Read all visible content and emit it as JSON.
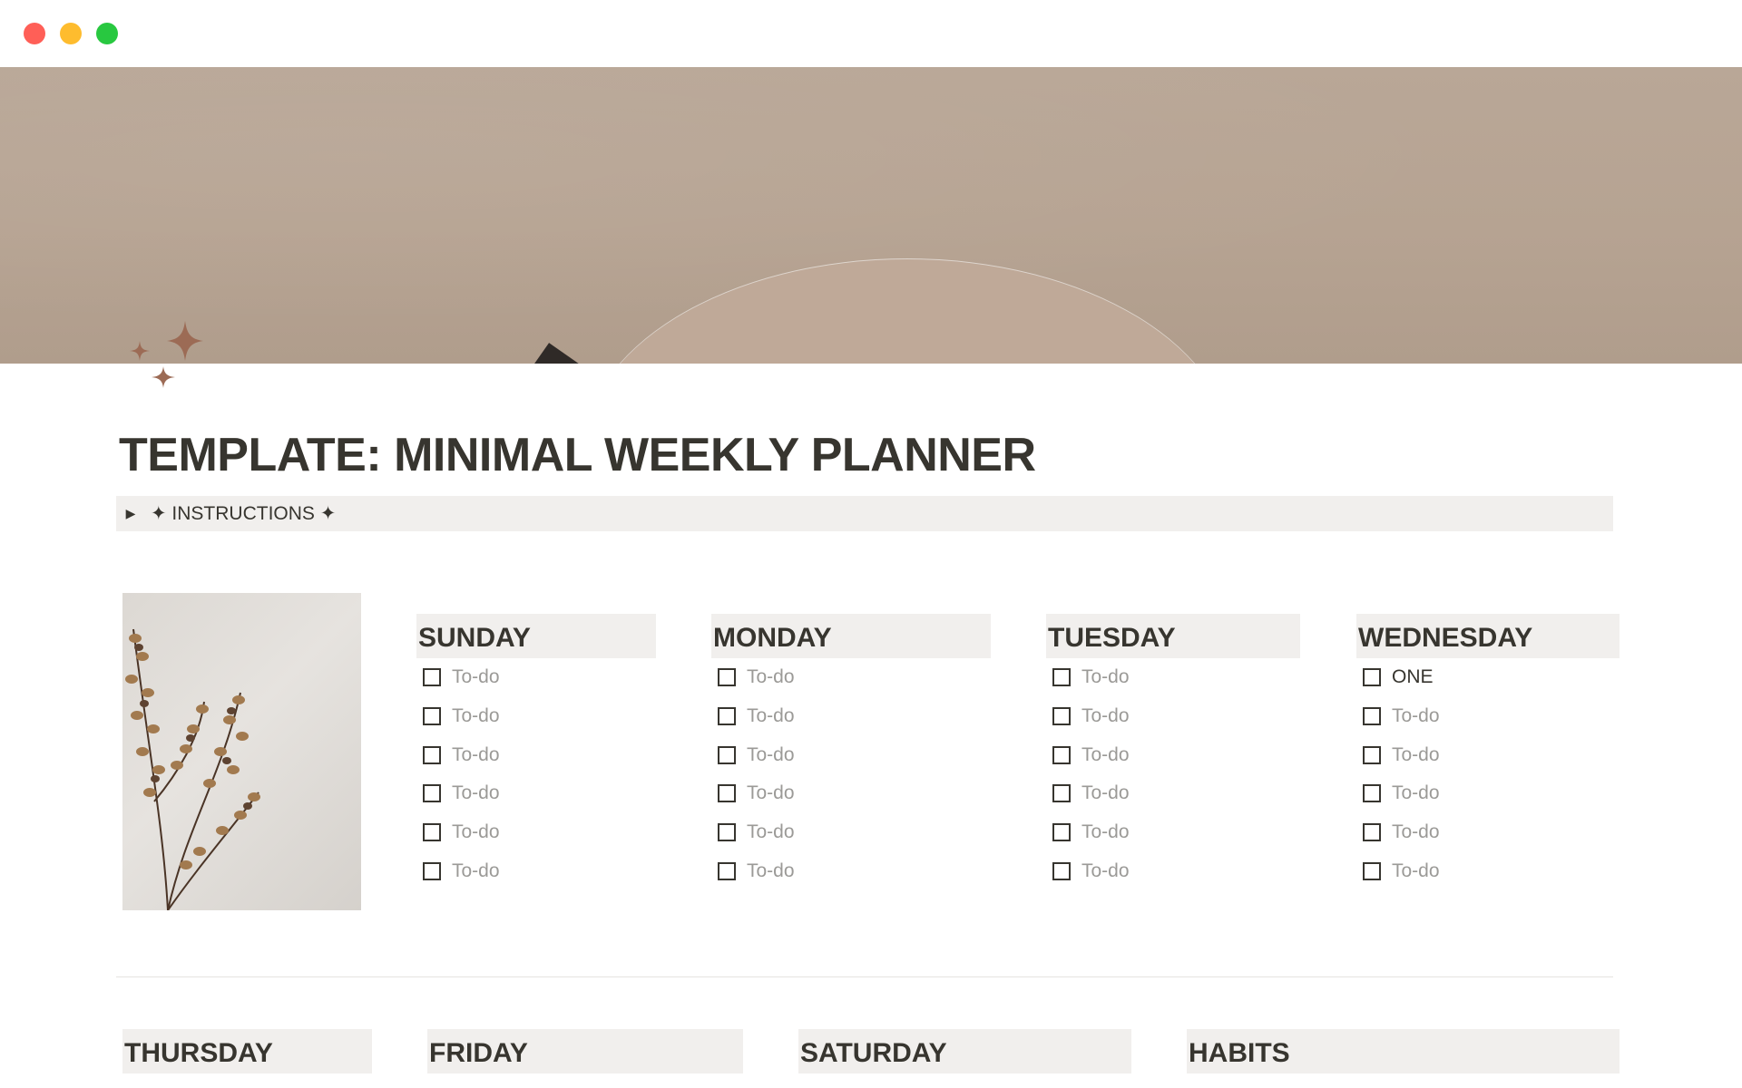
{
  "page": {
    "title": "TEMPLATE: MINIMAL WEEKLY PLANNER",
    "icon": "sparkles-icon",
    "accent_color": "#9c6b55"
  },
  "instructions": {
    "arrow": "▶",
    "label": "✦ INSTRUCTIONS ✦"
  },
  "week_top": [
    {
      "day": "SUNDAY",
      "todos": [
        "To-do",
        "To-do",
        "To-do",
        "To-do",
        "To-do",
        "To-do"
      ]
    },
    {
      "day": "MONDAY",
      "todos": [
        "To-do",
        "To-do",
        "To-do",
        "To-do",
        "To-do",
        "To-do"
      ]
    },
    {
      "day": "TUESDAY",
      "todos": [
        "To-do",
        "To-do",
        "To-do",
        "To-do",
        "To-do",
        "To-do"
      ]
    },
    {
      "day": "WEDNESDAY",
      "todos": [
        "ONE",
        "To-do",
        "To-do",
        "To-do",
        "To-do",
        "To-do"
      ]
    }
  ],
  "week_bottom": [
    {
      "day": "THURSDAY"
    },
    {
      "day": "FRIDAY"
    },
    {
      "day": "SATURDAY"
    },
    {
      "day": "HABITS"
    }
  ]
}
